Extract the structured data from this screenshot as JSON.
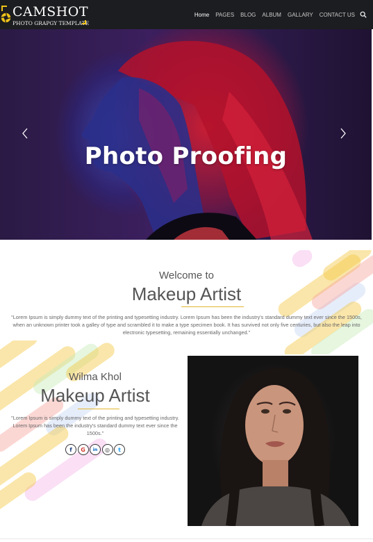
{
  "brand": {
    "name": "CAMSHOT",
    "tagline": "PHOTO GRAPGY TEMPLATE",
    "accent": "#f0c419"
  },
  "nav": {
    "items": [
      {
        "label": "Home",
        "active": true
      },
      {
        "label": "PAGES",
        "active": false
      },
      {
        "label": "BLOG",
        "active": false
      },
      {
        "label": "ALBUM",
        "active": false
      },
      {
        "label": "GALLARY",
        "active": false
      },
      {
        "label": "CONTACT US",
        "active": false
      }
    ],
    "search_icon": "search-icon"
  },
  "hero": {
    "title": "Photo Proofing",
    "prev_icon": "chevron-left-icon",
    "next_icon": "chevron-right-icon"
  },
  "welcome": {
    "heading_small": "Welcome to",
    "heading_large": "Makeup Artist",
    "body": "\"Lorem Ipsum is simply dummy text of the printing and typesetting industry. Lorem Ipsum has been the industry's standard dummy text ever since the 1500s, when an unknown printer took a galley of type and scrambled it to make a type specimen book. It has survived not only five centuries, but also the leap into electronic typesetting, remaining essentially unchanged.\""
  },
  "profile": {
    "name": "Wilma Khol",
    "role": "Makeup Artist",
    "body": "\"Lorem Ipsum is simply dummy text of the printing and typesetting industry. Lorem Ipsum has been the industry's standard dummy text ever since the 1500s.\"",
    "socials": [
      {
        "icon": "facebook-icon",
        "glyph": "f",
        "color": "#1c3d7a"
      },
      {
        "icon": "google-icon",
        "glyph": "G",
        "color": "#d23b2f"
      },
      {
        "icon": "linkedin-icon",
        "glyph": "in",
        "color": "#0a66c2"
      },
      {
        "icon": "instagram-icon",
        "glyph": "◎",
        "color": "#333333"
      },
      {
        "icon": "twitter-icon",
        "glyph": "t",
        "color": "#1d9bf0"
      }
    ]
  }
}
